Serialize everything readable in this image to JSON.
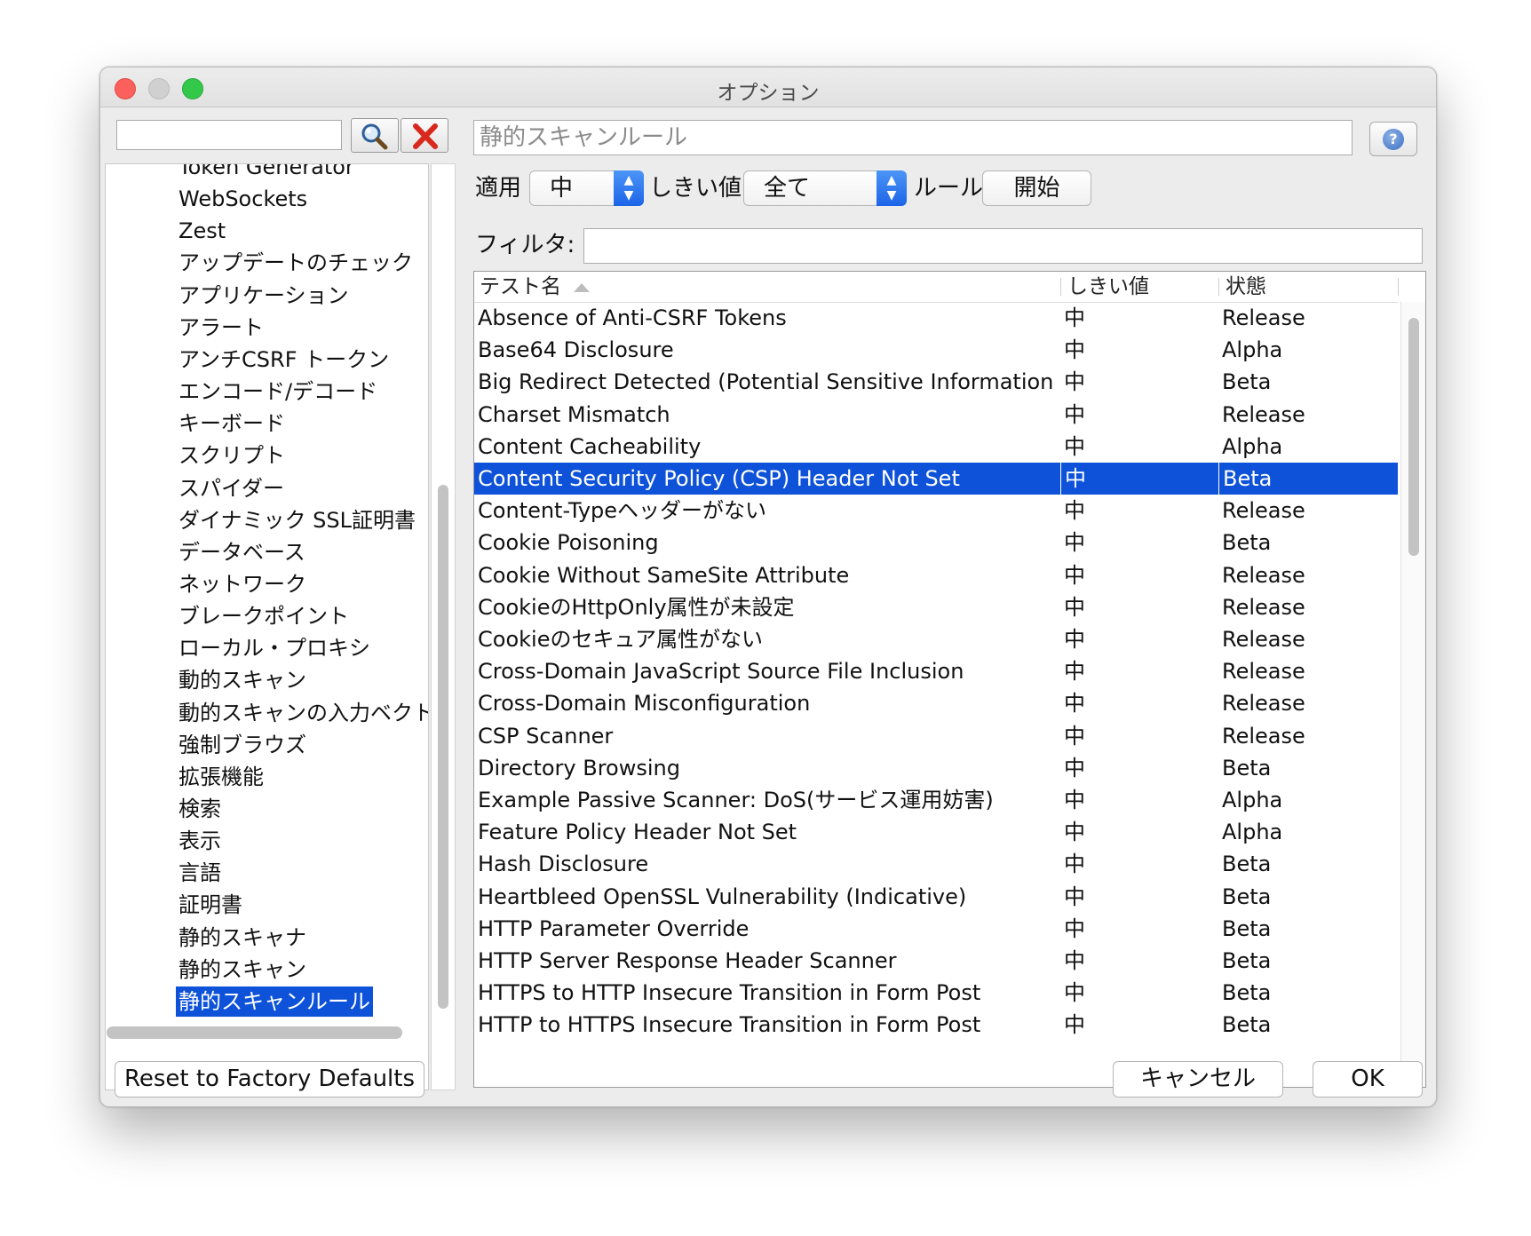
{
  "window": {
    "title": "オプション"
  },
  "sidebar": {
    "search_placeholder": "",
    "items": [
      "Token Generator",
      "WebSockets",
      "Zest",
      "アップデートのチェック",
      "アプリケーション",
      "アラート",
      "アンチCSRF トークン",
      "エンコード/デコード",
      "キーボード",
      "スクリプト",
      "スパイダー",
      "ダイナミック SSL証明書",
      "データベース",
      "ネットワーク",
      "ブレークポイント",
      "ローカル・プロキシ",
      "動的スキャン",
      "動的スキャンの入力ベクト",
      "強制ブラウズ",
      "拡張機能",
      "検索",
      "表示",
      "言語",
      "証明書",
      "静的スキャナ",
      "静的スキャン",
      "静的スキャンルール"
    ],
    "selected_index": 26
  },
  "panel": {
    "title": "静的スキャンルール",
    "apply_label": "適用",
    "apply_value": "中",
    "threshold_label": "しきい値",
    "threshold_value": "全て",
    "rules_label": "ルール",
    "start_button": "開始",
    "filter_label": "フィルタ:",
    "filter_value": ""
  },
  "table": {
    "columns": [
      "テスト名",
      "しきい値",
      "状態"
    ],
    "selected_index": 5,
    "rows": [
      [
        "Absence of Anti-CSRF Tokens",
        "中",
        "Release"
      ],
      [
        "Base64 Disclosure",
        "中",
        "Alpha"
      ],
      [
        "Big Redirect Detected (Potential Sensitive Information ...",
        "中",
        "Beta"
      ],
      [
        "Charset Mismatch",
        "中",
        "Release"
      ],
      [
        "Content Cacheability",
        "中",
        "Alpha"
      ],
      [
        "Content Security Policy (CSP) Header Not Set",
        "中",
        "Beta"
      ],
      [
        "Content-Typeヘッダーがない",
        "中",
        "Release"
      ],
      [
        "Cookie Poisoning",
        "中",
        "Beta"
      ],
      [
        "Cookie Without SameSite Attribute",
        "中",
        "Release"
      ],
      [
        "CookieのHttpOnly属性が未設定",
        "中",
        "Release"
      ],
      [
        "Cookieのセキュア属性がない",
        "中",
        "Release"
      ],
      [
        "Cross-Domain JavaScript Source File Inclusion",
        "中",
        "Release"
      ],
      [
        "Cross-Domain Misconfiguration",
        "中",
        "Release"
      ],
      [
        "CSP Scanner",
        "中",
        "Release"
      ],
      [
        "Directory Browsing",
        "中",
        "Beta"
      ],
      [
        "Example Passive Scanner: DoS(サービス運用妨害)",
        "中",
        "Alpha"
      ],
      [
        "Feature Policy Header Not Set",
        "中",
        "Alpha"
      ],
      [
        "Hash Disclosure",
        "中",
        "Beta"
      ],
      [
        "Heartbleed OpenSSL Vulnerability (Indicative)",
        "中",
        "Beta"
      ],
      [
        "HTTP Parameter Override",
        "中",
        "Beta"
      ],
      [
        "HTTP Server Response Header Scanner",
        "中",
        "Beta"
      ],
      [
        "HTTPS to HTTP Insecure Transition in Form Post",
        "中",
        "Beta"
      ],
      [
        "HTTP to HTTPS Insecure Transition in Form Post",
        "中",
        "Beta"
      ]
    ]
  },
  "footer": {
    "reset_button": "Reset to Factory Defaults",
    "cancel_button": "キャンセル",
    "ok_button": "OK"
  },
  "icons": {
    "search": "search-icon",
    "clear": "close-icon",
    "help": "help-icon",
    "sort": "sort-ascending-icon"
  },
  "colors": {
    "selection": "#0d52d8",
    "combo_arrow": "#1c64e8"
  }
}
